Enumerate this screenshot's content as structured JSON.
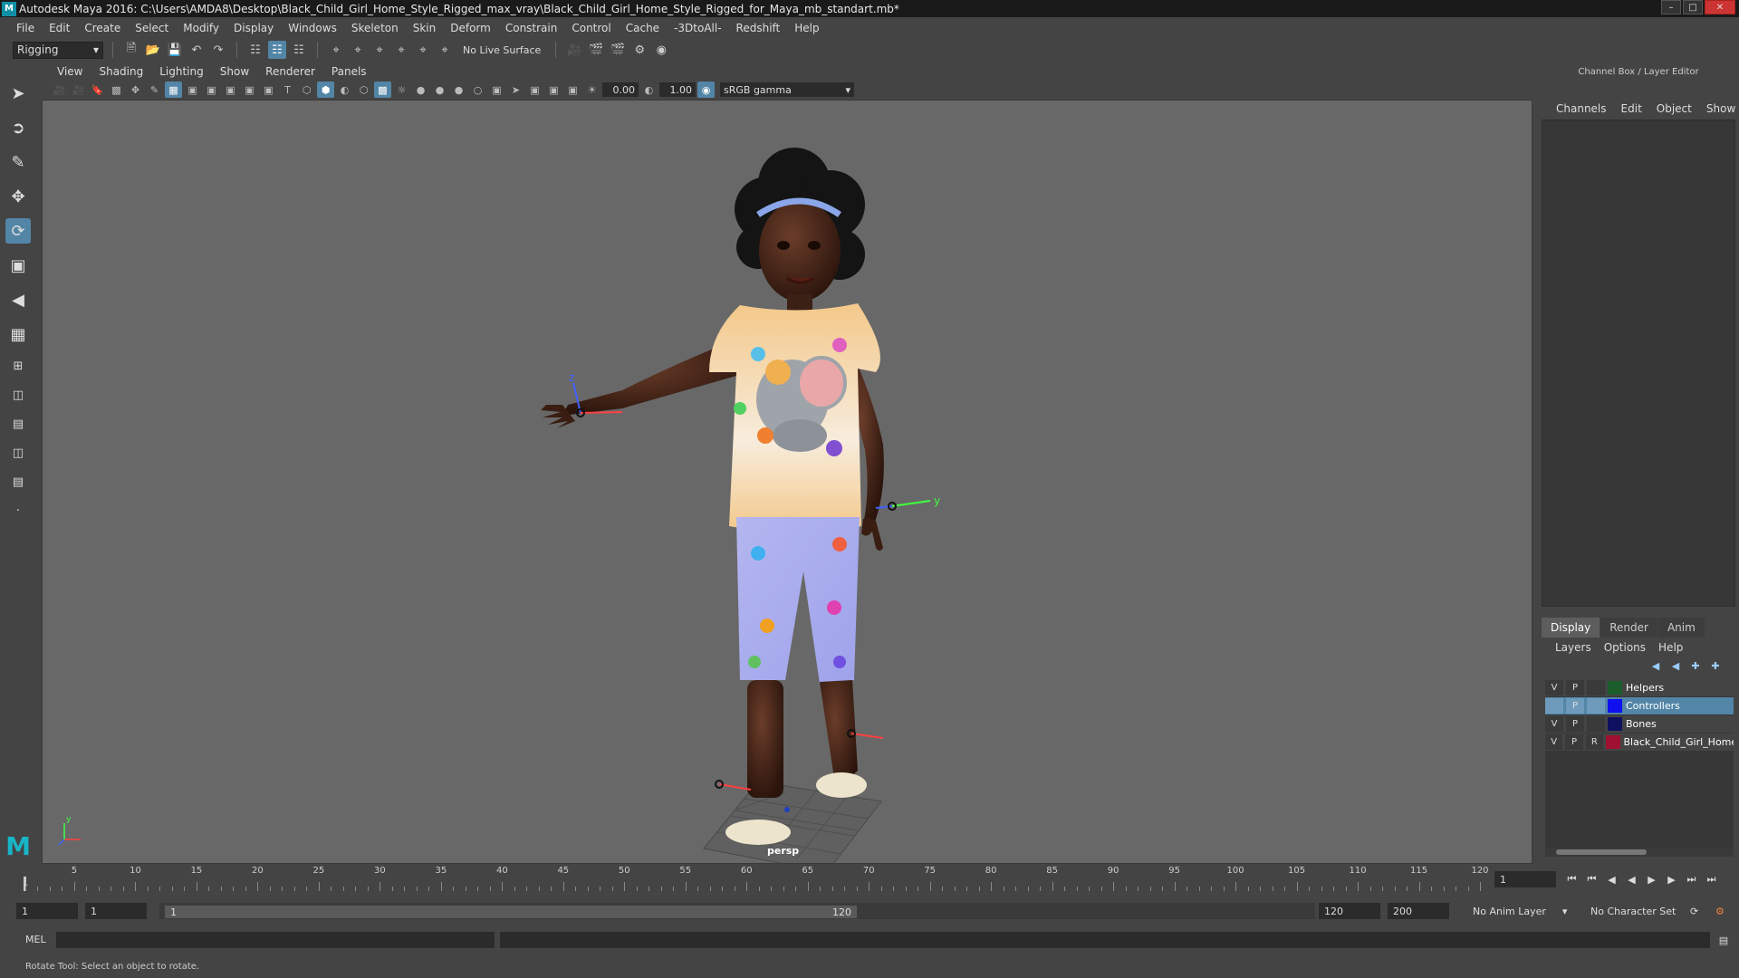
{
  "window": {
    "title": "Autodesk Maya 2016: C:\\Users\\AMDA8\\Desktop\\Black_Child_Girl_Home_Style_Rigged_max_vray\\Black_Child_Girl_Home_Style_Rigged_for_Maya_mb_standart.mb*"
  },
  "menubar": {
    "items": [
      "File",
      "Edit",
      "Create",
      "Select",
      "Modify",
      "Display",
      "Windows",
      "Skeleton",
      "Skin",
      "Deform",
      "Constrain",
      "Control",
      "Cache",
      "-3DtoAll-",
      "Redshift",
      "Help"
    ]
  },
  "statusline": {
    "mode": "Rigging",
    "live_surface": "No Live Surface"
  },
  "panel": {
    "menus": [
      "View",
      "Shading",
      "Lighting",
      "Show",
      "Renderer",
      "Panels"
    ],
    "exposure": "0.00",
    "gamma": "1.00",
    "color_space": "sRGB gamma",
    "camera": "persp"
  },
  "axes": {
    "x": "x",
    "y": "y",
    "z": "z"
  },
  "channel_box": {
    "header": "Channel Box / Layer Editor",
    "menus": [
      "Channels",
      "Edit",
      "Object",
      "Show"
    ]
  },
  "layer_editor": {
    "tabs": [
      "Display",
      "Render",
      "Anim"
    ],
    "active_tab": "Display",
    "menus": [
      "Layers",
      "Options",
      "Help"
    ],
    "layers": [
      {
        "v": "V",
        "p": "P",
        "r": "",
        "name": "Helpers",
        "color": "#1a5c2a",
        "selected": false
      },
      {
        "v": "",
        "p": "P",
        "r": "",
        "name": "Controllers",
        "color": "#1010ee",
        "selected": true
      },
      {
        "v": "V",
        "p": "P",
        "r": "",
        "name": "Bones",
        "color": "#101060",
        "selected": false
      },
      {
        "v": "V",
        "p": "P",
        "r": "R",
        "name": "Black_Child_Girl_Home",
        "color": "#a01030",
        "selected": false
      }
    ]
  },
  "timeline": {
    "ticks": [
      "1",
      "5",
      "10",
      "15",
      "20",
      "25",
      "30",
      "35",
      "40",
      "45",
      "50",
      "55",
      "60",
      "65",
      "70",
      "75",
      "80",
      "85",
      "90",
      "95",
      "100",
      "105",
      "110",
      "115",
      "120"
    ],
    "current_frame": "1"
  },
  "range": {
    "start": "1",
    "playback_start": "1",
    "handle_start": "1",
    "handle_end": "120",
    "playback_end": "120",
    "end": "200",
    "anim_layer": "No Anim Layer",
    "character_set": "No Character Set"
  },
  "command_line": {
    "label": "MEL"
  },
  "help_line": {
    "text": "Rotate Tool: Select an object to rotate."
  },
  "colors": {
    "accent": "#5285a6",
    "viewport_bg": "#686868",
    "panel_bg": "#444444"
  }
}
